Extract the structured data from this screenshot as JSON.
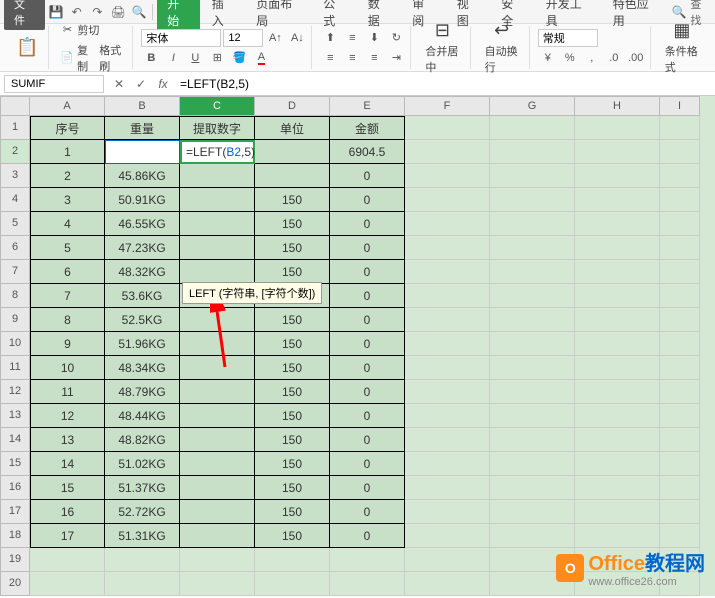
{
  "menu": {
    "file": "文件",
    "tabs": [
      "开始",
      "插入",
      "页面布局",
      "公式",
      "数据",
      "审阅",
      "视图",
      "安全",
      "开发工具",
      "特色应用"
    ],
    "active_tab": 0,
    "search": "查找"
  },
  "ribbon": {
    "cut": "剪切",
    "copy": "复制",
    "format_painter": "格式刷",
    "font_name": "宋体",
    "font_size": "12",
    "merge_center": "合并居中",
    "auto_wrap": "自动换行",
    "number_format": "常规",
    "cond_format": "条件格式"
  },
  "formula_bar": {
    "name_box": "SUMIF",
    "formula": "=LEFT(B2,5)"
  },
  "columns": [
    "A",
    "B",
    "C",
    "D",
    "E",
    "F",
    "G",
    "H",
    "I"
  ],
  "selected_col": "C",
  "header_row": [
    "序号",
    "重量",
    "提取数字",
    "单位",
    "金额"
  ],
  "editing_cell": {
    "display_prefix": "=LEFT(",
    "display_ref": "B2",
    "display_suffix": ",5)"
  },
  "tooltip": "LEFT (字符串, [字符个数])",
  "rows": [
    {
      "n": "1",
      "w": "",
      "c": "",
      "d": "",
      "e": "6904.5"
    },
    {
      "n": "2",
      "w": "45.86KG",
      "c": "",
      "d": "",
      "e": "0"
    },
    {
      "n": "3",
      "w": "50.91KG",
      "c": "",
      "d": "150",
      "e": "0"
    },
    {
      "n": "4",
      "w": "46.55KG",
      "c": "",
      "d": "150",
      "e": "0"
    },
    {
      "n": "5",
      "w": "47.23KG",
      "c": "",
      "d": "150",
      "e": "0"
    },
    {
      "n": "6",
      "w": "48.32KG",
      "c": "",
      "d": "150",
      "e": "0"
    },
    {
      "n": "7",
      "w": "53.6KG",
      "c": "",
      "d": "150",
      "e": "0"
    },
    {
      "n": "8",
      "w": "52.5KG",
      "c": "",
      "d": "150",
      "e": "0"
    },
    {
      "n": "9",
      "w": "51.96KG",
      "c": "",
      "d": "150",
      "e": "0"
    },
    {
      "n": "10",
      "w": "48.34KG",
      "c": "",
      "d": "150",
      "e": "0"
    },
    {
      "n": "11",
      "w": "48.79KG",
      "c": "",
      "d": "150",
      "e": "0"
    },
    {
      "n": "12",
      "w": "48.44KG",
      "c": "",
      "d": "150",
      "e": "0"
    },
    {
      "n": "13",
      "w": "48.82KG",
      "c": "",
      "d": "150",
      "e": "0"
    },
    {
      "n": "14",
      "w": "51.02KG",
      "c": "",
      "d": "150",
      "e": "0"
    },
    {
      "n": "15",
      "w": "51.37KG",
      "c": "",
      "d": "150",
      "e": "0"
    },
    {
      "n": "16",
      "w": "52.72KG",
      "c": "",
      "d": "150",
      "e": "0"
    },
    {
      "n": "17",
      "w": "51.31KG",
      "c": "",
      "d": "150",
      "e": "0"
    }
  ],
  "watermark": {
    "brand1": "Office",
    "brand2": "教程网",
    "url": "www.office26.com"
  }
}
